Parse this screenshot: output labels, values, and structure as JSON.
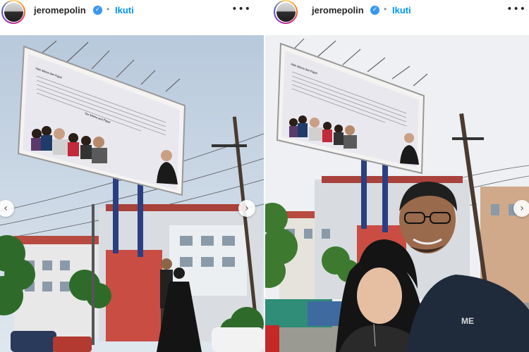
{
  "posts": [
    {
      "username": "jeromepolin",
      "verified_icon": "verified-badge-icon",
      "separator": "•",
      "follow_label": "Ikuti",
      "more_icon": "more-options-icon",
      "more_glyph": "•••",
      "next_glyph": "›",
      "prev_glyph": "‹",
      "billboard": {
        "greeting": "Halo Mama dan Papa!",
        "closing": "Our Mama and Papa!"
      }
    },
    {
      "username": "jeromepolin",
      "verified_icon": "verified-badge-icon",
      "separator": "•",
      "follow_label": "Ikuti",
      "more_icon": "more-options-icon",
      "more_glyph": "•••",
      "next_glyph": "›",
      "billboard": {
        "greeting": "Halo Mama dan Papa!"
      },
      "shirt_text": "ME"
    }
  ],
  "colors": {
    "follow": "#0095f6",
    "verified": "#3897f0",
    "sky_left": "#c9d6e4",
    "sky_right": "#eef1f4"
  }
}
